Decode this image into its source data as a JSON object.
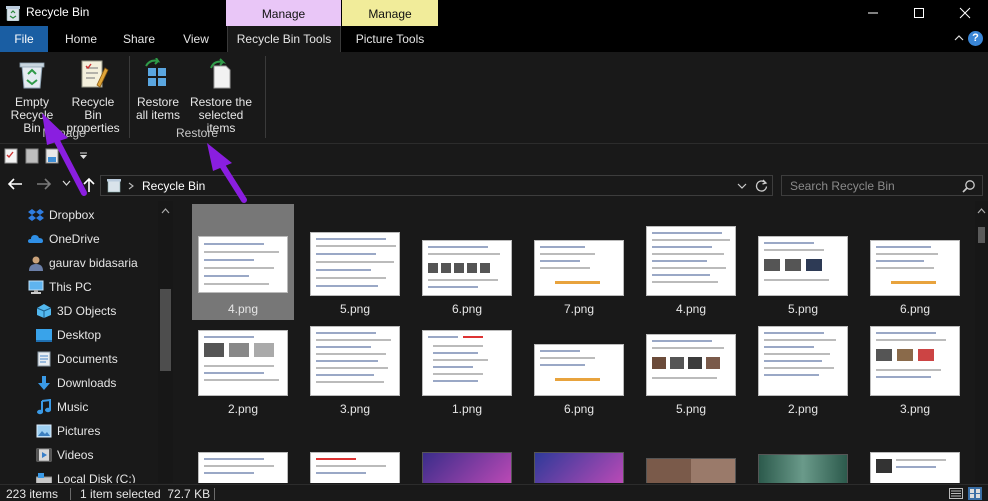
{
  "window": {
    "title": "Recycle Bin",
    "context_tabs": [
      "Manage",
      "Manage"
    ]
  },
  "tabs": {
    "file": "File",
    "home": "Home",
    "share": "Share",
    "view": "View",
    "recycle_bin_tools": "Recycle Bin Tools",
    "picture_tools": "Picture Tools",
    "help": "?"
  },
  "ribbon": {
    "empty_line1": "Empty",
    "empty_line2": "Recycle Bin",
    "props_line1": "Recycle Bin",
    "props_line2": "properties",
    "restore_all_line1": "Restore",
    "restore_all_line2": "all items",
    "restore_sel_line1": "Restore the",
    "restore_sel_line2": "selected items",
    "group_manage": "Manage",
    "group_restore": "Restore"
  },
  "address": {
    "location": "Recycle Bin",
    "search_placeholder": "Search Recycle Bin"
  },
  "nav_items": [
    {
      "label": "Dropbox",
      "icon": "dropbox-icon"
    },
    {
      "label": "OneDrive",
      "icon": "onedrive-icon"
    },
    {
      "label": "gaurav bidasaria",
      "icon": "user-icon"
    },
    {
      "label": "This PC",
      "icon": "pc-icon"
    },
    {
      "label": "3D Objects",
      "icon": "3d-objects-icon"
    },
    {
      "label": "Desktop",
      "icon": "desktop-icon"
    },
    {
      "label": "Documents",
      "icon": "documents-icon"
    },
    {
      "label": "Downloads",
      "icon": "downloads-icon"
    },
    {
      "label": "Music",
      "icon": "music-icon"
    },
    {
      "label": "Pictures",
      "icon": "pictures-icon"
    },
    {
      "label": "Videos",
      "icon": "videos-icon"
    },
    {
      "label": "Local Disk (C:)",
      "icon": "disk-icon"
    }
  ],
  "files_row1": [
    "4.png",
    "5.png",
    "6.png",
    "7.png",
    "4.png",
    "5.png",
    "6.png"
  ],
  "files_row2": [
    "2.png",
    "3.png",
    "1.png",
    "6.png",
    "5.png",
    "2.png",
    "3.png"
  ],
  "status": {
    "count": "223 items",
    "selected": "1 item selected  72.7 KB"
  },
  "colors": {
    "accent_file_tab": "#1a5ea3",
    "manage_tab_1": "#e9c6f7",
    "manage_tab_2": "#f1ec9a",
    "annotation_arrow": "#8a1ee0"
  }
}
